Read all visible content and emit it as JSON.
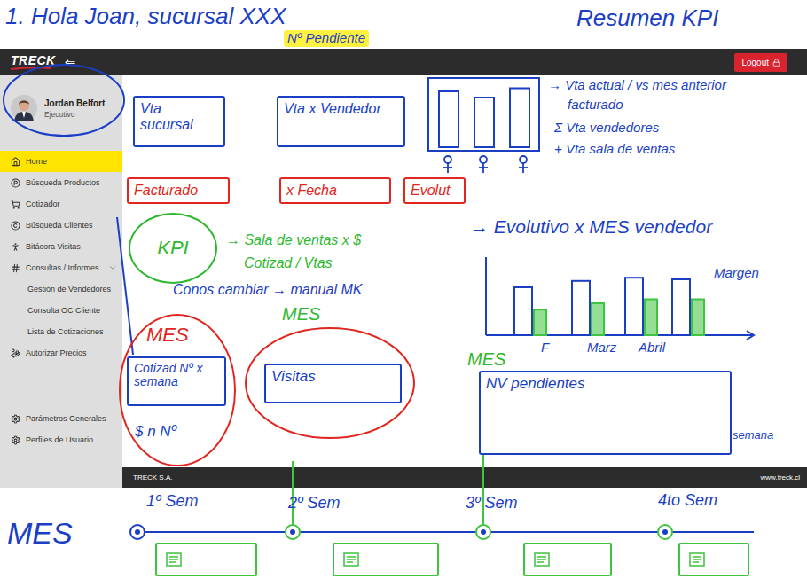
{
  "header": {
    "logo": "TRECK",
    "toggle": "⇐",
    "logout": "Logout"
  },
  "profile": {
    "name": "Jordan Belfort",
    "role": "Ejecutivo"
  },
  "sidebar": {
    "items": [
      {
        "label": "Home",
        "selected": true,
        "kind": "main"
      },
      {
        "label": "Búsqueda Productos",
        "selected": false,
        "kind": "main"
      },
      {
        "label": "Cotizador",
        "selected": false,
        "kind": "main"
      },
      {
        "label": "Búsqueda Clientes",
        "selected": false,
        "kind": "main"
      },
      {
        "label": "Bitácora Visitas",
        "selected": false,
        "kind": "main"
      },
      {
        "label": "Consultas / Informes",
        "selected": false,
        "kind": "group",
        "expanded": true
      },
      {
        "label": "Gestión de Vendedores",
        "selected": false,
        "kind": "sub"
      },
      {
        "label": "Consulta OC Cliente",
        "selected": false,
        "kind": "sub"
      },
      {
        "label": "Lista de Cotizaciones",
        "selected": false,
        "kind": "sub"
      },
      {
        "label": "Autorizar Precios",
        "selected": false,
        "kind": "main"
      }
    ],
    "bottom_items": [
      {
        "label": "Parámetros Generales",
        "selected": false,
        "kind": "main"
      },
      {
        "label": "Perfiles de Usuario",
        "selected": false,
        "kind": "main"
      }
    ]
  },
  "footer": {
    "company": "TRECK S.A.",
    "url": "www.treck.cl"
  },
  "annotations": [
    {
      "text": "1. Hola Joan, sucursal XXX",
      "color": "#1b3fc4",
      "kind": "text"
    },
    {
      "text": "Nº Pendiente",
      "color": "#1b3fc4",
      "kind": "highlight"
    },
    {
      "text": "Resumen KPI",
      "color": "#1b3fc4",
      "kind": "text"
    },
    {
      "text": "Vta sucursal",
      "color": "#1b3fc4",
      "kind": "box"
    },
    {
      "text": "Vta x Vendedor",
      "color": "#1b3fc4",
      "kind": "box"
    },
    {
      "text": "→ Vta actual / vs mes anterior",
      "color": "#1b3fc4",
      "kind": "text"
    },
    {
      "text": "facturado",
      "color": "#1b3fc4",
      "kind": "text"
    },
    {
      "text": "Σ Vta vendedores",
      "color": "#1b3fc4",
      "kind": "text"
    },
    {
      "text": "+ Vta sala de ventas",
      "color": "#1b3fc4",
      "kind": "text"
    },
    {
      "text": "Facturado",
      "color": "#e0261e",
      "kind": "box"
    },
    {
      "text": "x Fecha",
      "color": "#e0261e",
      "kind": "box"
    },
    {
      "text": "Evolut",
      "color": "#e0261e",
      "kind": "box"
    },
    {
      "text": "→ Evolutivo x MES vendedor",
      "color": "#1b3fc4",
      "kind": "text"
    },
    {
      "text": "KPI",
      "color": "#2fb82f",
      "kind": "circle"
    },
    {
      "text": "→ Sala de ventas x $",
      "color": "#2fb82f",
      "kind": "text"
    },
    {
      "text": "Cotizad / Vtas",
      "color": "#2fb82f",
      "kind": "text"
    },
    {
      "text": "Conos cambiar → manual MK",
      "color": "#1b3fc4",
      "kind": "text"
    },
    {
      "text": "MES",
      "color": "#e0261e",
      "kind": "text"
    },
    {
      "text": "Cotizad Nº x semana",
      "color": "#1b3fc4",
      "kind": "box"
    },
    {
      "text": "$ n Nº",
      "color": "#1b3fc4",
      "kind": "text"
    },
    {
      "text": "MES",
      "color": "#2fb82f",
      "kind": "text"
    },
    {
      "text": "Visitas",
      "color": "#1b3fc4",
      "kind": "box"
    },
    {
      "text": "MES",
      "color": "#2fb82f",
      "kind": "text"
    },
    {
      "text": "NV pendientes",
      "color": "#1b3fc4",
      "kind": "box"
    },
    {
      "text": "semana",
      "color": "#1b3fc4",
      "kind": "text"
    },
    {
      "text": "MES",
      "color": "#1b3fc4",
      "kind": "text"
    }
  ],
  "sketch_chart": {
    "color": "#1b3fc4",
    "values": [
      90,
      80,
      95
    ]
  },
  "evolutivo_chart": {
    "series": [
      {
        "color": "#1b3fc4",
        "values": [
          60,
          68,
          72,
          70
        ]
      },
      {
        "color": "#3ec43e",
        "values": [
          32,
          40,
          45,
          45
        ]
      }
    ],
    "ticks": [
      "F",
      "Marz",
      "Abril"
    ],
    "legend": "Margen"
  },
  "timeline": {
    "color": "#3ec43e",
    "weeks": [
      "1º Sem",
      "2º Sem",
      "3º Sem",
      "4to Sem"
    ]
  }
}
